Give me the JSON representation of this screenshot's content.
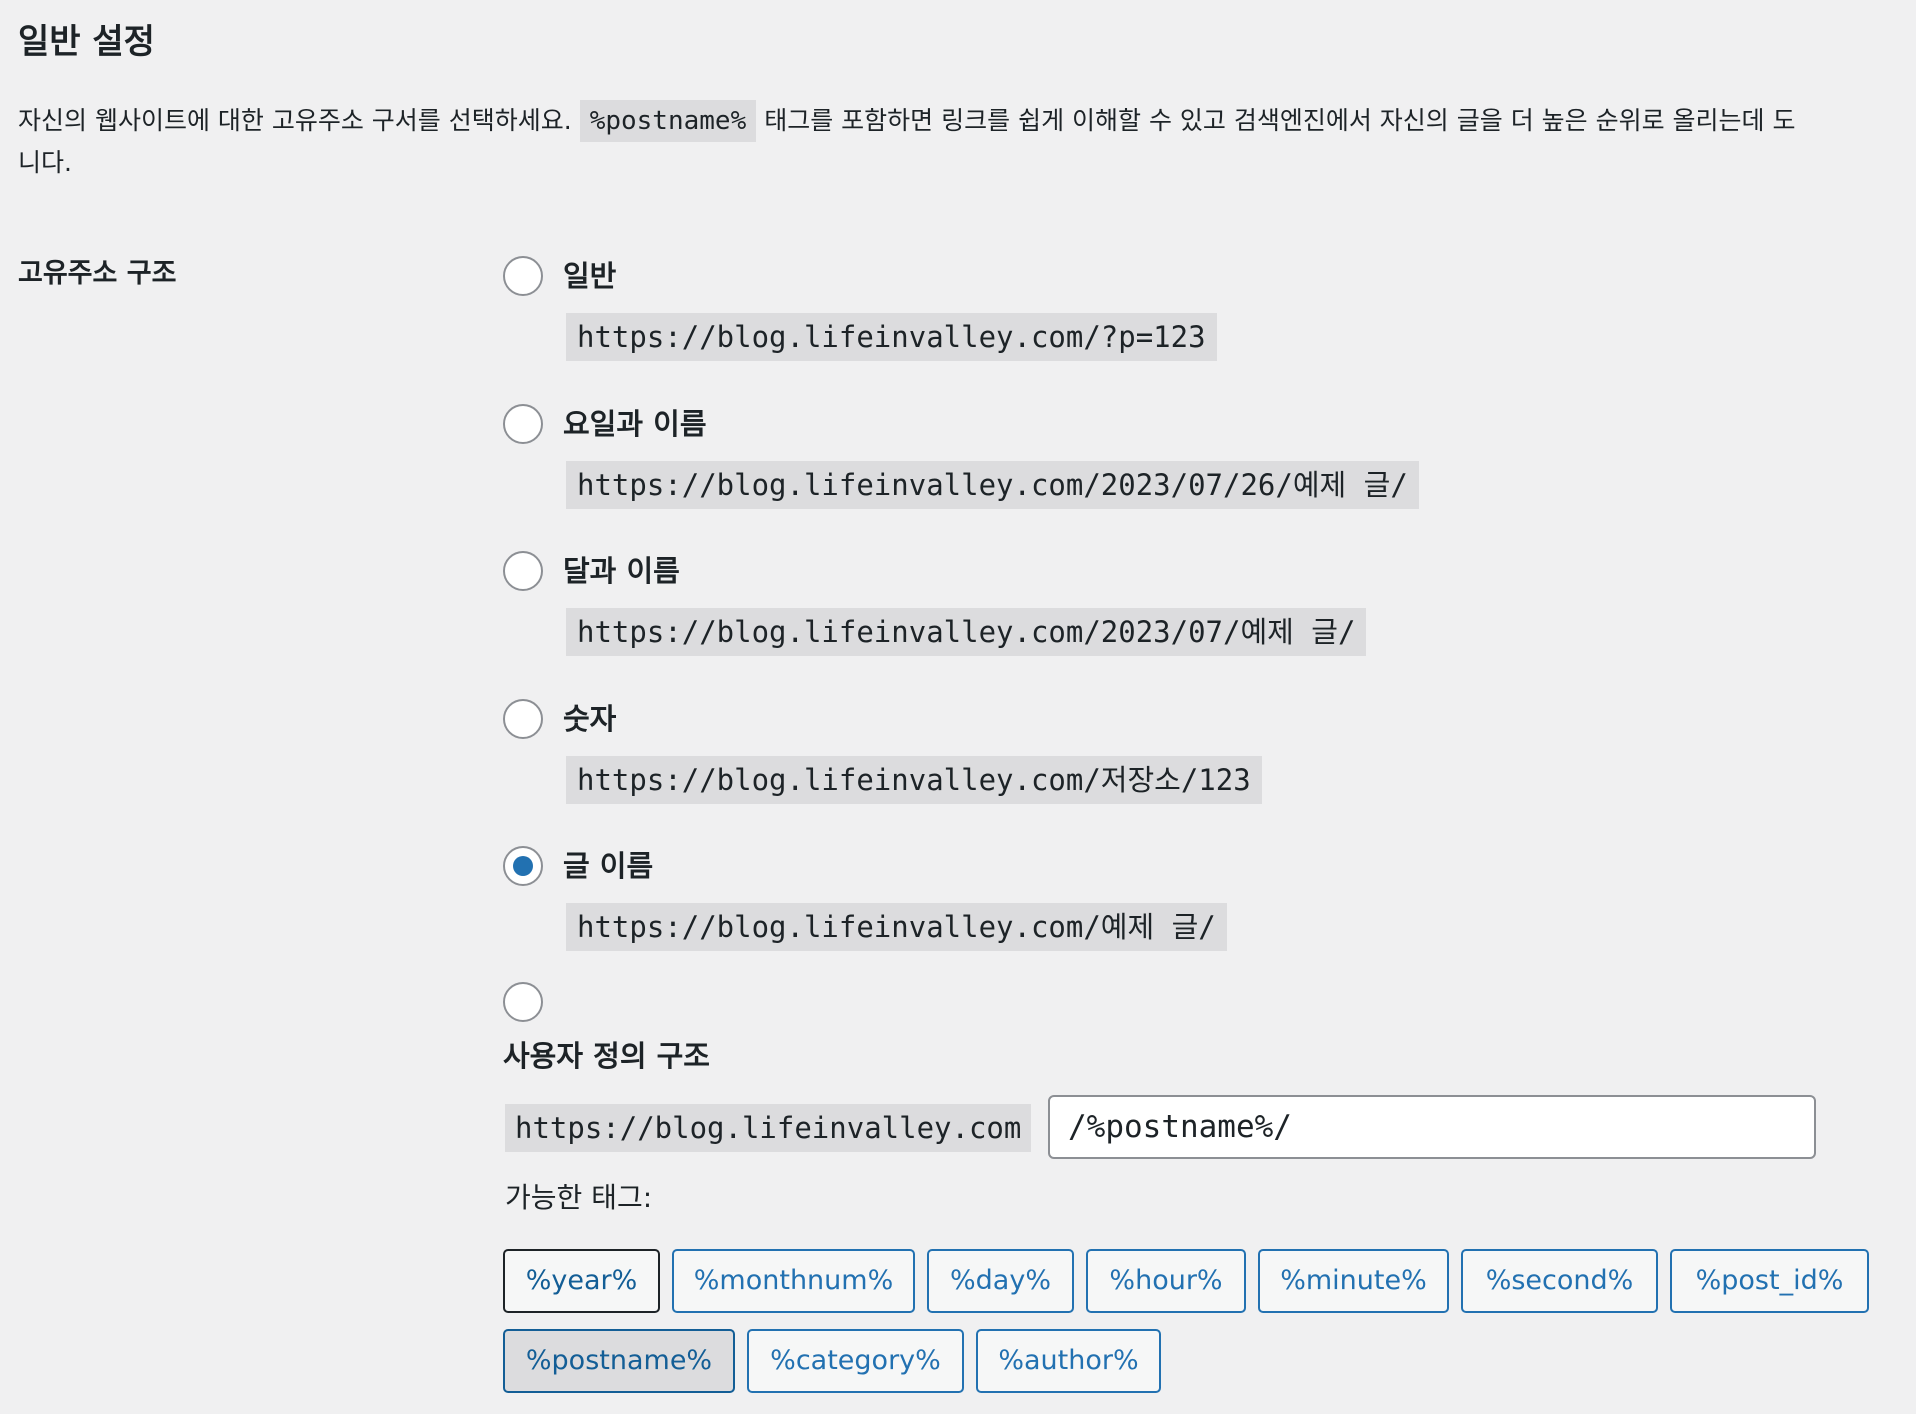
{
  "section": {
    "title": "일반 설정",
    "description_before": "자신의 웹사이트에 대한 고유주소 구서를 선택하세요.",
    "description_code": "%postname%",
    "description_after": "태그를 포함하면 링크를 쉽게 이해할 수 있고 검색엔진에서 자신의 글을 더 높은 순위로 올리는데 도",
    "description_line2": "니다."
  },
  "permalink": {
    "row_label": "고유주소 구조",
    "options": [
      {
        "label": "일반",
        "example": "https://blog.lifeinvalley.com/?p=123",
        "checked": false
      },
      {
        "label": "요일과 이름",
        "example": "https://blog.lifeinvalley.com/2023/07/26/예제 글/",
        "checked": false
      },
      {
        "label": "달과 이름",
        "example": "https://blog.lifeinvalley.com/2023/07/예제 글/",
        "checked": false
      },
      {
        "label": "숫자",
        "example": "https://blog.lifeinvalley.com/저장소/123",
        "checked": false
      },
      {
        "label": "글 이름",
        "example": "https://blog.lifeinvalley.com/예제 글/",
        "checked": true
      }
    ],
    "custom": {
      "label": "사용자 정의 구조",
      "prefix": "https://blog.lifeinvalley.com",
      "value": "/%postname%/",
      "checked": false
    },
    "available_tags_label": "가능한 태그:",
    "tags": [
      "%year%",
      "%monthnum%",
      "%day%",
      "%hour%",
      "%minute%",
      "%second%",
      "%post_id%",
      "%postname%",
      "%category%",
      "%author%"
    ],
    "active_tag": "%postname%",
    "colors": {
      "accent": "#2271b1",
      "background": "#f0f0f1",
      "code_background": "#dcdcde"
    }
  }
}
